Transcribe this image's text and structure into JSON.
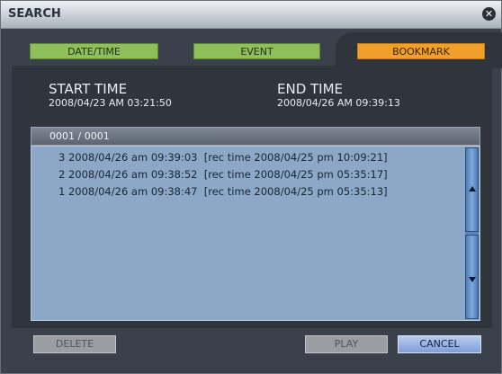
{
  "window": {
    "title": "SEARCH",
    "close_glyph": "✕"
  },
  "tabs": [
    {
      "label": "DATE/TIME",
      "active": false
    },
    {
      "label": "EVENT",
      "active": false
    },
    {
      "label": "BOOKMARK",
      "active": true
    }
  ],
  "start": {
    "label": "START TIME",
    "value": "2008/04/23 AM 03:21:50"
  },
  "end": {
    "label": "END TIME",
    "value": "2008/04/26 AM 09:39:13"
  },
  "list": {
    "header": "0001 / 0001",
    "rows": [
      "3 2008/04/26 am 09:39:03  [rec time 2008/04/25 pm 10:09:21]",
      "2 2008/04/26 am 09:38:52  [rec time 2008/04/25 pm 05:35:17]",
      "1 2008/04/26 am 09:38:47  [rec time 2008/04/25 pm 05:35:13]"
    ]
  },
  "buttons": {
    "delete": "DELETE",
    "play": "PLAY",
    "cancel": "CANCEL"
  },
  "icons": {
    "close": "close-icon",
    "scroll_up": "arrow-up-icon",
    "scroll_down": "arrow-down-icon"
  },
  "colors": {
    "accent_active_tab": "#f0a02a",
    "tab": "#8ebf5b",
    "list_bg": "#8ca8c6"
  }
}
